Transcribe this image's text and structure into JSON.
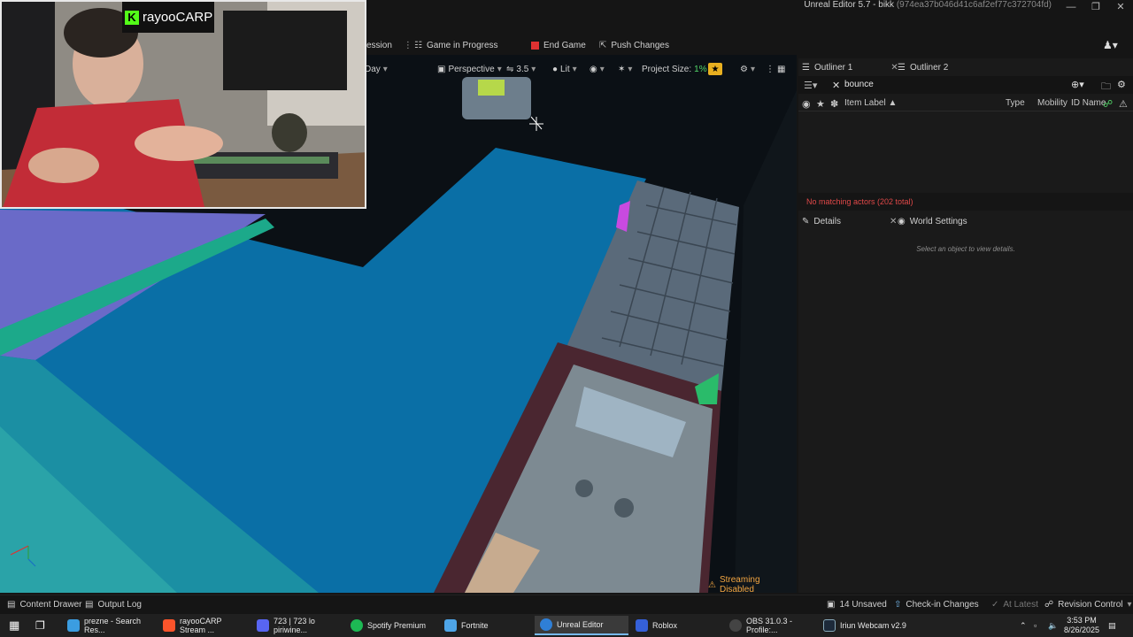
{
  "window": {
    "title": "Unreal Editor 5.7 - bikk",
    "hash": "(974ea37b046d41c6af2ef77c372704fd)"
  },
  "webcam": {
    "channel": "rayooCARP"
  },
  "menubar": {
    "session_label": "ession",
    "game_progress": "Game in Progress",
    "end_game": "End Game",
    "push_changes": "Push Changes"
  },
  "viewport_toolbar": {
    "day": "Day",
    "perspective": "Perspective",
    "speed": "3.5",
    "lit": "Lit",
    "project_size_label": "Project Size:",
    "project_size_value": "1%"
  },
  "viewport": {
    "streaming": "Streaming Disabled"
  },
  "outliner": {
    "tab1": "Outliner 1",
    "tab2": "Outliner 2",
    "search_value": "bounce",
    "col_item_label": "Item Label",
    "col_type": "Type",
    "col_mobility": "Mobility",
    "col_id_name": "ID Name",
    "no_match": "No matching actors (202 total)"
  },
  "details": {
    "tab1": "Details",
    "tab2": "World Settings",
    "empty": "Select an object to view details."
  },
  "statusbar": {
    "content_drawer": "Content Drawer",
    "output_log": "Output Log",
    "unsaved": "14 Unsaved",
    "check_in": "Check-in Changes",
    "at_latest": "At Latest",
    "revision": "Revision Control"
  },
  "taskbar": {
    "items": [
      {
        "label": "prezne - Search Res...",
        "color": "#3b9de1"
      },
      {
        "label": "rayooCARP Stream ...",
        "color": "#fb542b"
      },
      {
        "label": "723 | 723 lo piriwine...",
        "color": "#5865f2"
      },
      {
        "label": "Spotify Premium",
        "color": "#1db954"
      },
      {
        "label": "Fortnite",
        "color": "#4ea5e8"
      },
      {
        "label": "Unreal Editor",
        "color": "#2f7fd6"
      },
      {
        "label": "Roblox",
        "color": "#3560d9"
      },
      {
        "label": "OBS 31.0.3 - Profile:...",
        "color": "#444444"
      },
      {
        "label": "Iriun Webcam v2.9",
        "color": "#1d2a3a"
      }
    ],
    "time": "3:53 PM",
    "date": "8/26/2025"
  }
}
